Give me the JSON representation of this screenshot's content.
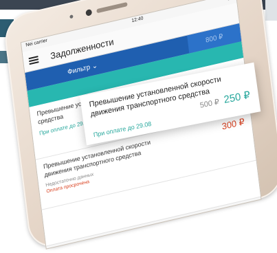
{
  "status_bar": {
    "carrier": "Nei carrier",
    "time": "12:40"
  },
  "header": {
    "title": "Задолженности"
  },
  "filter": {
    "label": "Фильтр",
    "chevron": "chevron-down-icon",
    "amount": "800 ₽"
  },
  "items": [
    {
      "title": "Превышение установленной скорости движения транспортного средства",
      "discount_label": "При оплате до 29.08",
      "old_price": "500 ₽",
      "new_price": "250 ₽"
    },
    {
      "title": "Превышение установленной скорости движения транспортного средства",
      "tag": "Недостаточно данных",
      "status": "Оплата просрочена",
      "price": "300 ₽"
    }
  ],
  "colors": {
    "accent_blue": "#1f5fb0",
    "teal": "#28b7b0",
    "price_red": "#d9401f",
    "price_green": "#28a89d"
  }
}
